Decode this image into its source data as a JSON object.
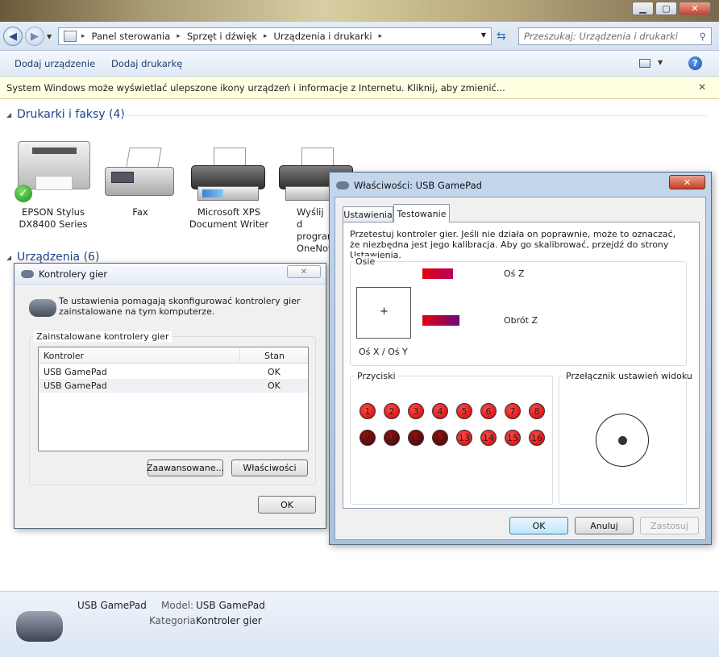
{
  "window": {
    "minimize_label": "▁",
    "maximize_label": "▢",
    "close_label": "✕"
  },
  "address": {
    "crumbs": [
      "Panel sterowania",
      "Sprzęt i dźwięk",
      "Urządzenia i drukarki"
    ],
    "search_placeholder": "Przeszukaj: Urządzenia i drukarki"
  },
  "toolbar": {
    "add_device": "Dodaj urządzenie",
    "add_printer": "Dodaj drukarkę"
  },
  "infobar": {
    "text": "System Windows może wyświetlać ulepszone ikony urządzeń i informacje z Internetu. Kliknij, aby zmienić..."
  },
  "printers_group": {
    "title": "Drukarki i faksy (4)",
    "items": [
      {
        "line1": "EPSON Stylus",
        "line2": "DX8400 Series"
      },
      {
        "line1": "Fax",
        "line2": ""
      },
      {
        "line1": "Microsoft XPS",
        "line2": "Document Writer"
      },
      {
        "line1": "Wyślij d",
        "line2": "program",
        "line3": "OneNote"
      }
    ]
  },
  "devices_group": {
    "title": "Urządzenia (6)"
  },
  "game_controllers": {
    "title": "Kontrolery gier",
    "description": "Te ustawienia pomagają skonfigurować kontrolery gier zainstalowane na tym komputerze.",
    "group_label": "Zainstalowane kontrolery gier",
    "columns": [
      "Kontroler",
      "Stan"
    ],
    "rows": [
      {
        "name": "USB GamePad",
        "status": "OK"
      },
      {
        "name": "USB GamePad",
        "status": "OK"
      }
    ],
    "advanced_button": "Zaawansowane...",
    "properties_button": "Właściwości",
    "ok_button": "OK",
    "close_label": "✕"
  },
  "properties": {
    "title": "Właściwości: USB GamePad",
    "tabs": [
      "Ustawienia",
      "Testowanie"
    ],
    "active_tab": "Testowanie",
    "instructions": "Przetestuj kontroler gier. Jeśli nie działa on poprawnie, może to oznaczać, że niezbędna jest jego kalibracja. Aby go skalibrować, przejdź do strony Ustawienia.",
    "axes_label": "Osie",
    "z_axis_label": "Oś Z",
    "z_rotation_label": "Obrót Z",
    "xy_label": "Oś X / Oś Y",
    "crosshair": "+",
    "buttons_label": "Przyciski",
    "buttons": [
      "1",
      "2",
      "3",
      "4",
      "5",
      "6",
      "7",
      "8",
      "9",
      "10",
      "11",
      "12",
      "13",
      "14",
      "15",
      "16"
    ],
    "pov_label": "Przełącznik ustawień widoku",
    "ok_button": "OK",
    "cancel_button": "Anuluj",
    "apply_button": "Zastosuj",
    "close_label": "✕"
  },
  "details": {
    "name": "USB GamePad",
    "model_label": "Model:",
    "model_value": "USB GamePad",
    "category_label": "Kategoria:",
    "category_value": "Kontroler gier"
  },
  "colors": {
    "accent_blue": "#1e3f8a",
    "info_bar": "#ffffe1",
    "button_red": "#d40000"
  }
}
